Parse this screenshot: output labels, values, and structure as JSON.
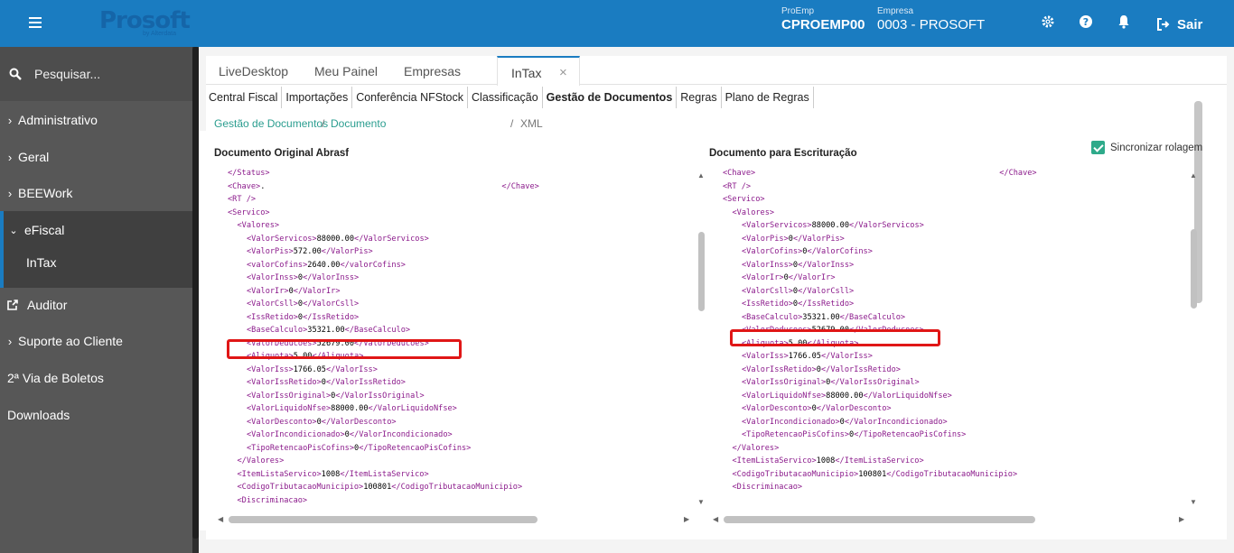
{
  "header": {
    "logo": "Prosoft",
    "logo_sub": "by Alterdata",
    "proemp_label": "ProEmp",
    "proemp_value": "CPROEMP00",
    "empresa_label": "Empresa",
    "empresa_value": "0003 - PROSOFT",
    "sair_label": "Sair"
  },
  "sidebar": {
    "search_placeholder": "Pesquisar...",
    "items": [
      {
        "label": "Administrativo",
        "chevron": "›"
      },
      {
        "label": "Geral",
        "chevron": "›"
      },
      {
        "label": "BEEWork",
        "chevron": "›"
      },
      {
        "label": "eFiscal",
        "chevron": "⌄"
      },
      {
        "label": "InTax",
        "chevron": ""
      },
      {
        "label": "Auditor",
        "chevron": ""
      },
      {
        "label": "Suporte ao Cliente",
        "chevron": "›"
      },
      {
        "label": "2ª Via de Boletos",
        "chevron": ""
      },
      {
        "label": "Downloads",
        "chevron": ""
      }
    ]
  },
  "tabs": [
    {
      "label": "LiveDesktop"
    },
    {
      "label": "Meu Painel"
    },
    {
      "label": "Empresas"
    },
    {
      "label": "InTax",
      "close": "×"
    }
  ],
  "subnav": [
    "Central Fiscal",
    "Importações",
    "Conferência NFStock",
    "Classificação",
    "Gestão de Documentos",
    "Regras",
    "Plano de Regras"
  ],
  "breadcrumb": {
    "item1": "Gestão de Documentos",
    "sep1": "/",
    "item2": "Documento",
    "sep2": "/",
    "item3": "XML"
  },
  "left_pane": {
    "title": "Documento Original Abrasf",
    "lines": [
      {
        "i": 2,
        "t": "</Status>",
        "v": ""
      },
      {
        "i": 2,
        "t": "<Chave>",
        "v": ".",
        "close": "</Chave>"
      },
      {
        "i": 2,
        "t": "<RT />",
        "v": ""
      },
      {
        "i": 2,
        "t": "<Servico>",
        "v": ""
      },
      {
        "i": 3,
        "t": "<Valores>",
        "v": ""
      },
      {
        "i": 4,
        "t": "<ValorServicos>",
        "v": "88000.00",
        "close": "</ValorServicos>"
      },
      {
        "i": 4,
        "t": "<ValorPis>",
        "v": "572.00",
        "close": "</ValorPis>"
      },
      {
        "i": 4,
        "t": "<valorCofins>",
        "v": "2640.00",
        "close": "</valorCofins>"
      },
      {
        "i": 4,
        "t": "<ValorInss>",
        "v": "0",
        "close": "</ValorInss>"
      },
      {
        "i": 4,
        "t": "<ValorIr>",
        "v": "0",
        "close": "</ValorIr>"
      },
      {
        "i": 4,
        "t": "<ValorCsll>",
        "v": "0",
        "close": "</ValorCsll>"
      },
      {
        "i": 4,
        "t": "<IssRetido>",
        "v": "0",
        "close": "</IssRetido>"
      },
      {
        "i": 4,
        "t": "<BaseCalculo>",
        "v": "35321.00",
        "close": "</BaseCalculo>"
      },
      {
        "i": 4,
        "t": "<ValorDeducoes>",
        "v": "52679.00",
        "close": "</ValorDeducoes>"
      },
      {
        "i": 4,
        "t": "<Aliquota>",
        "v": "5.00",
        "close": "</Aliquota>"
      },
      {
        "i": 4,
        "t": "<ValorIss>",
        "v": "1766.05",
        "close": "</ValorIss>"
      },
      {
        "i": 4,
        "t": "<ValorIssRetido>",
        "v": "0",
        "close": "</ValorIssRetido>"
      },
      {
        "i": 4,
        "t": "<ValorIssOriginal>",
        "v": "0",
        "close": "</ValorIssOriginal>"
      },
      {
        "i": 4,
        "t": "<ValorLiquidoNfse>",
        "v": "88000.00",
        "close": "</ValorLiquidoNfse>"
      },
      {
        "i": 4,
        "t": "<ValorDesconto>",
        "v": "0",
        "close": "</ValorDesconto>"
      },
      {
        "i": 4,
        "t": "<ValorIncondicionado>",
        "v": "0",
        "close": "</ValorIncondicionado>"
      },
      {
        "i": 4,
        "t": "<TipoRetencaoPisCofins>",
        "v": "0",
        "close": "</TipoRetencaoPisCofins>"
      },
      {
        "i": 3,
        "t": "</Valores>",
        "v": ""
      },
      {
        "i": 3,
        "t": "<ItemListaServico>",
        "v": "1008",
        "close": "</ItemListaServico>"
      },
      {
        "i": 3,
        "t": "<CodigoTributacaoMunicipio>",
        "v": "100801",
        "close": "</CodigoTributacaoMunicipio>"
      },
      {
        "i": 3,
        "t": "<Discriminacao>",
        "v": ""
      }
    ]
  },
  "right_pane": {
    "title": "Documento para Escrituração",
    "sync_label": "Sincronizar rolagem",
    "lines": [
      {
        "i": 2,
        "t": "<Chave>",
        "v": "",
        "close": "</Chave>"
      },
      {
        "i": 2,
        "t": "<RT />",
        "v": ""
      },
      {
        "i": 2,
        "t": "<Servico>",
        "v": ""
      },
      {
        "i": 3,
        "t": "<Valores>",
        "v": ""
      },
      {
        "i": 4,
        "t": "<ValorServicos>",
        "v": "88000.00",
        "close": "</ValorServicos>"
      },
      {
        "i": 4,
        "t": "<ValorPis>",
        "v": "0",
        "close": "</ValorPis>"
      },
      {
        "i": 4,
        "t": "<ValorCofins>",
        "v": "0",
        "close": "</ValorCofins>"
      },
      {
        "i": 4,
        "t": "<ValorInss>",
        "v": "0",
        "close": "</ValorInss>"
      },
      {
        "i": 4,
        "t": "<ValorIr>",
        "v": "0",
        "close": "</ValorIr>"
      },
      {
        "i": 4,
        "t": "<ValorCsll>",
        "v": "0",
        "close": "</ValorCsll>"
      },
      {
        "i": 4,
        "t": "<IssRetido>",
        "v": "0",
        "close": "</IssRetido>"
      },
      {
        "i": 4,
        "t": "<BaseCalculo>",
        "v": "35321.00",
        "close": "</BaseCalculo>"
      },
      {
        "i": 4,
        "t": "<ValorDeducoes>",
        "v": "52679.00",
        "close": "</ValorDeducoes>"
      },
      {
        "i": 4,
        "t": "<Aliquota>",
        "v": "5.00",
        "close": "</Aliquota>"
      },
      {
        "i": 4,
        "t": "<ValorIss>",
        "v": "1766.05",
        "close": "</ValorIss>"
      },
      {
        "i": 4,
        "t": "<ValorIssRetido>",
        "v": "0",
        "close": "</ValorIssRetido>"
      },
      {
        "i": 4,
        "t": "<ValorIssOriginal>",
        "v": "0",
        "close": "</ValorIssOriginal>"
      },
      {
        "i": 4,
        "t": "<ValorLiquidoNfse>",
        "v": "88000.00",
        "close": "</ValorLiquidoNfse>"
      },
      {
        "i": 4,
        "t": "<ValorDesconto>",
        "v": "0",
        "close": "</ValorDesconto>"
      },
      {
        "i": 4,
        "t": "<ValorIncondicionado>",
        "v": "0",
        "close": "</ValorIncondicionado>"
      },
      {
        "i": 4,
        "t": "<TipoRetencaoPisCofins>",
        "v": "0",
        "close": "</TipoRetencaoPisCofins>"
      },
      {
        "i": 3,
        "t": "</Valores>",
        "v": ""
      },
      {
        "i": 3,
        "t": "<ItemListaServico>",
        "v": "1008",
        "close": "</ItemListaServico>"
      },
      {
        "i": 3,
        "t": "<CodigoTributacaoMunicipio>",
        "v": "100801",
        "close": "</CodigoTributacaoMunicipio>"
      },
      {
        "i": 3,
        "t": "<Discriminacao>",
        "v": ""
      }
    ]
  },
  "colors": {
    "brand": "#1a7cc1",
    "highlight": "#e01616",
    "xml_tag": "#8b1a8b",
    "link": "#2a9d8f"
  },
  "icons": [
    "menu-icon",
    "search-icon",
    "gear-icon",
    "help-icon",
    "bell-icon",
    "logout-icon",
    "external-link-icon",
    "check-icon"
  ]
}
